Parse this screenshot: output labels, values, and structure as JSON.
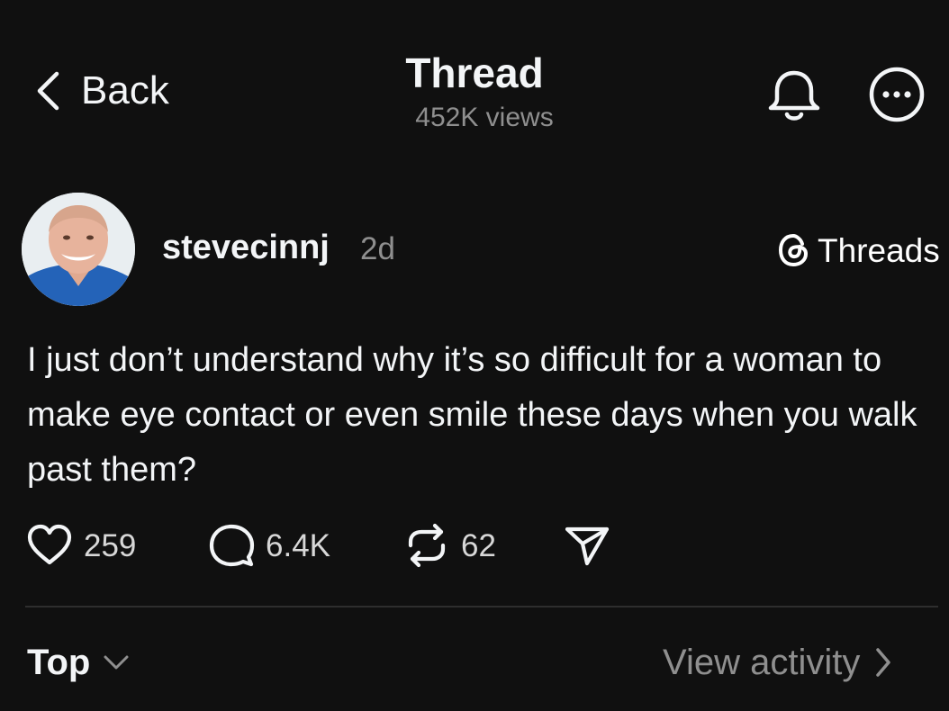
{
  "header": {
    "back_label": "Back",
    "title": "Thread",
    "views": "452K views",
    "icons": [
      "chevron-left-icon",
      "bell-icon",
      "more-icon"
    ]
  },
  "post": {
    "username": "stevecinnj",
    "time": "2d",
    "brand_label": "Threads",
    "text": "I just don’t understand why it’s so difficult for a woman to make eye contact or even smile these days when you walk past them?",
    "likes": "259",
    "replies": "6.4K",
    "reposts": "62"
  },
  "footer": {
    "sort_label": "Top",
    "activity_label": "View activity"
  },
  "colors": {
    "background": "#101010",
    "text": "#f3f5f7",
    "muted": "#8f8f8f",
    "divider": "#2e2e2e"
  }
}
